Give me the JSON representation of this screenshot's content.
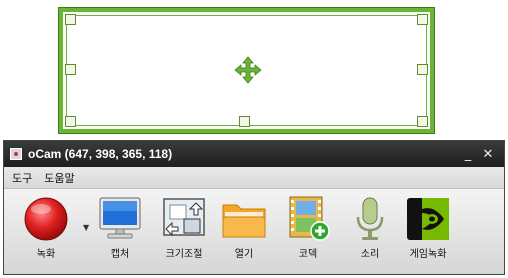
{
  "window": {
    "title": "oCam (647, 398, 365, 118)"
  },
  "menu": {
    "items": [
      "도구",
      "도움말"
    ]
  },
  "toolbar": {
    "record": "녹화",
    "capture": "캡처",
    "resize": "크기조절",
    "open": "열기",
    "codec": "코덱",
    "sound": "소리",
    "game_record": "게임녹화"
  },
  "colors": {
    "frame": "#6ab536",
    "record": "#e02020"
  }
}
